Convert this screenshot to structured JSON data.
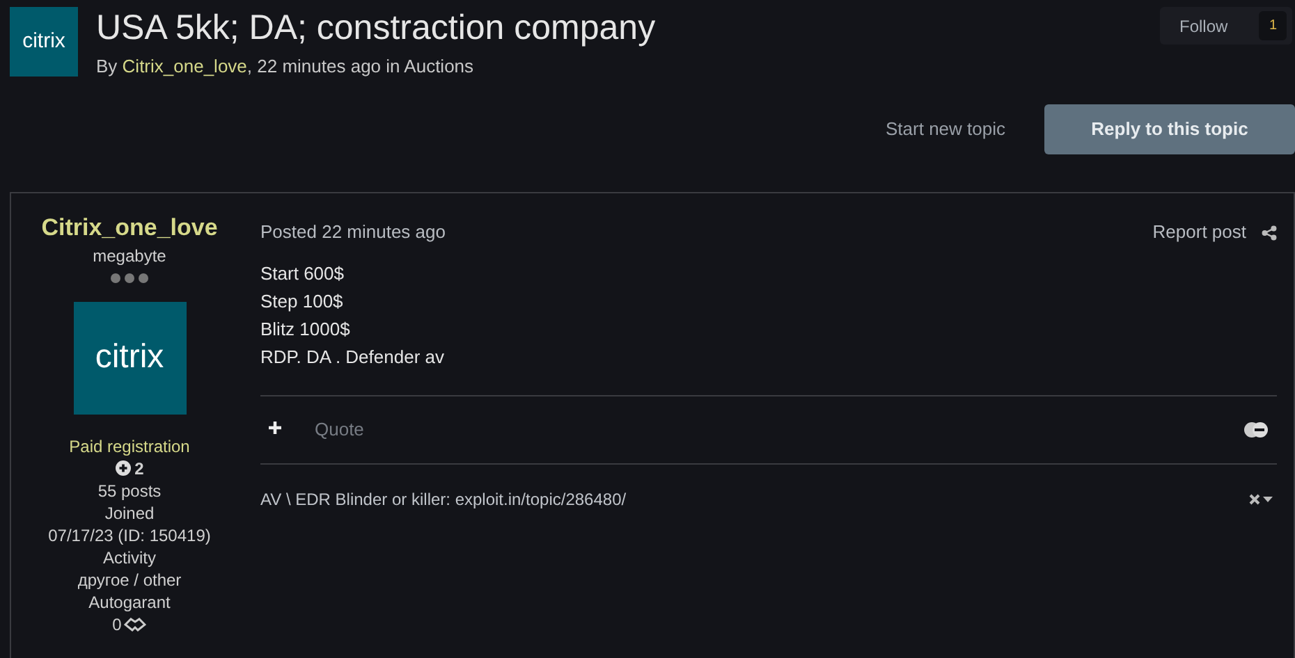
{
  "topic": {
    "logo_text": "citrix",
    "title": "USA 5kk; DA; constraction company",
    "by": "By",
    "author": "Citrix_one_love",
    "meta": ", 22 minutes ago in",
    "forum": "Auctions"
  },
  "follow": {
    "label": "Follow",
    "count": "1"
  },
  "actions": {
    "start_topic": "Start new topic",
    "reply": "Reply to this topic"
  },
  "post": {
    "author": {
      "name": "Citrix_one_love",
      "rank": "megabyte",
      "avatar_text": "citrix",
      "group": "Paid registration",
      "reputation": "2",
      "posts": "55 posts",
      "joined_label": "Joined",
      "joined": "07/17/23 (ID: 150419)",
      "activity_label": "Activity",
      "activity": "другое / other",
      "autogarant_label": "Autogarant",
      "autogarant": "0"
    },
    "posted": "Posted 22 minutes ago",
    "report": "Report post",
    "lines": [
      "Start 600$",
      "Step 100$",
      "Blitz 1000$",
      "RDP. DA . Defender av"
    ],
    "quote": "Quote",
    "signature": "AV \\ EDR Blinder or killer: exploit.in/topic/286480/"
  }
}
